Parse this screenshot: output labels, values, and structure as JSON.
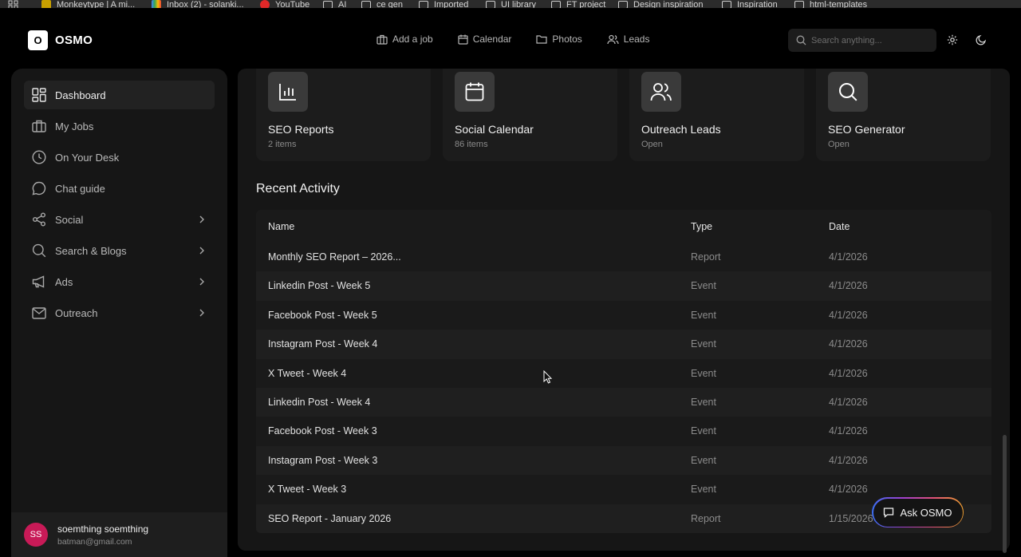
{
  "bookmarks": [
    {
      "label": "Monkeytype | A mi...",
      "icon": "monkeytype-icon"
    },
    {
      "label": "Inbox (2) - solanki...",
      "icon": "gmail-icon"
    },
    {
      "label": "YouTube",
      "icon": "youtube-icon"
    },
    {
      "label": "AI",
      "icon": "folder-icon"
    },
    {
      "label": "ce gen",
      "icon": "folder-icon"
    },
    {
      "label": "Imported",
      "icon": "folder-icon"
    },
    {
      "label": "UI library",
      "icon": "folder-icon"
    },
    {
      "label": "FT project",
      "icon": "folder-icon"
    },
    {
      "label": "Design inspiration",
      "icon": "folder-icon"
    },
    {
      "label": "Inspiration",
      "icon": "folder-icon"
    },
    {
      "label": "html-templates",
      "icon": "folder-icon"
    }
  ],
  "app": {
    "logo_letter": "O",
    "name": "OSMO"
  },
  "nav": [
    {
      "label": "Add a job",
      "icon": "briefcase-icon"
    },
    {
      "label": "Calendar",
      "icon": "calendar-icon"
    },
    {
      "label": "Photos",
      "icon": "folder-icon"
    },
    {
      "label": "Leads",
      "icon": "users-icon"
    }
  ],
  "search": {
    "placeholder": "Search anything..."
  },
  "sidebar": {
    "items": [
      {
        "label": "Dashboard",
        "icon": "dashboard-icon",
        "active": true
      },
      {
        "label": "My Jobs",
        "icon": "briefcase-icon"
      },
      {
        "label": "On Your Desk",
        "icon": "clock-icon"
      },
      {
        "label": "Chat guide",
        "icon": "chat-icon"
      },
      {
        "label": "Social",
        "icon": "share-icon",
        "expandable": true
      },
      {
        "label": "Search & Blogs",
        "icon": "search-icon",
        "expandable": true
      },
      {
        "label": "Ads",
        "icon": "megaphone-icon",
        "expandable": true
      },
      {
        "label": "Outreach",
        "icon": "mail-icon",
        "expandable": true
      }
    ],
    "user": {
      "initials": "SS",
      "name": "soemthing soemthing",
      "email": "batman@gmail.com"
    }
  },
  "cards": [
    {
      "title": "SEO Reports",
      "sub": "2 items",
      "icon": "bar-chart-icon"
    },
    {
      "title": "Social Calendar",
      "sub": "86 items",
      "icon": "calendar-icon"
    },
    {
      "title": "Outreach Leads",
      "sub": "Open",
      "icon": "users-icon"
    },
    {
      "title": "SEO Generator",
      "sub": "Open",
      "icon": "search-icon"
    }
  ],
  "activity": {
    "title": "Recent Activity",
    "columns": {
      "name": "Name",
      "type": "Type",
      "date": "Date"
    },
    "rows": [
      {
        "name": "Monthly SEO Report – 2026...",
        "type": "Report",
        "date": "4/1/2026"
      },
      {
        "name": "Linkedin Post - Week 5",
        "type": "Event",
        "date": "4/1/2026"
      },
      {
        "name": "Facebook Post - Week 5",
        "type": "Event",
        "date": "4/1/2026"
      },
      {
        "name": "Instagram Post - Week 4",
        "type": "Event",
        "date": "4/1/2026"
      },
      {
        "name": "X Tweet - Week 4",
        "type": "Event",
        "date": "4/1/2026"
      },
      {
        "name": "Linkedin Post - Week 4",
        "type": "Event",
        "date": "4/1/2026"
      },
      {
        "name": "Facebook Post - Week 3",
        "type": "Event",
        "date": "4/1/2026"
      },
      {
        "name": "Instagram Post - Week 3",
        "type": "Event",
        "date": "4/1/2026"
      },
      {
        "name": "X Tweet - Week 3",
        "type": "Event",
        "date": "4/1/2026"
      },
      {
        "name": "SEO Report - January 2026",
        "type": "Report",
        "date": "1/15/2026"
      }
    ]
  },
  "ask": {
    "label": "Ask OSMO"
  }
}
